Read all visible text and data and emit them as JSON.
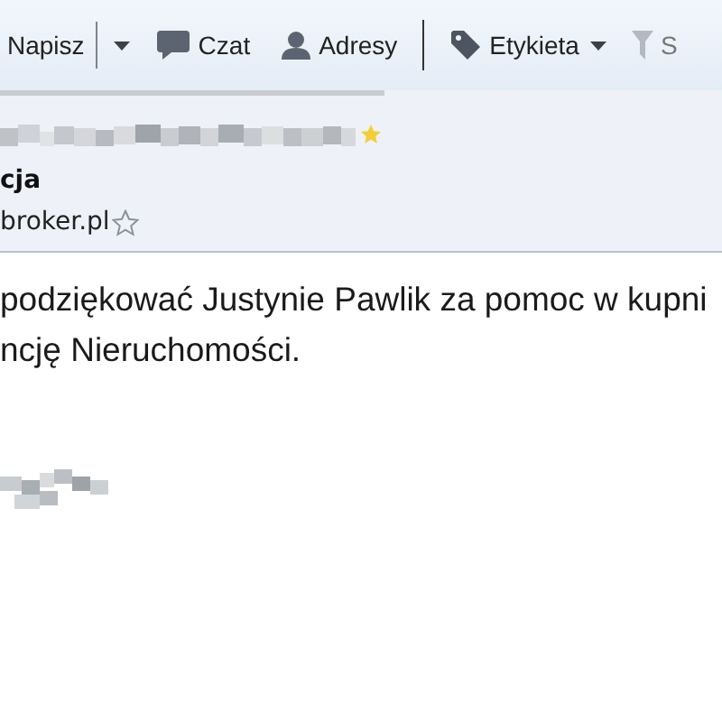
{
  "toolbar": {
    "groups": [
      [
        {
          "label": "Napisz",
          "kind": "compose",
          "dropdown": true
        },
        {
          "label": "Czat",
          "kind": "chat",
          "dropdown": false
        },
        {
          "label": "Adresy",
          "kind": "contacts",
          "dropdown": false
        }
      ],
      [
        {
          "label": "Etykieta",
          "kind": "tag",
          "dropdown": true
        },
        {
          "label": "S",
          "kind": "filter",
          "dropdown": false
        }
      ]
    ]
  },
  "header": {
    "subject_starred": true,
    "from_fragment": "cja",
    "address_fragment": "broker.pl",
    "address_starred": false
  },
  "body": {
    "lines": [
      "podziękować Justynie Pawlik za pomoc w kupni",
      "ncję Nieruchomości."
    ]
  }
}
